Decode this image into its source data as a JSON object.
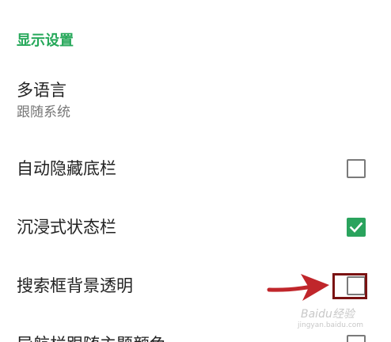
{
  "settings": {
    "section_header": "显示设置",
    "language": {
      "title": "多语言",
      "subtitle": "跟随系统"
    },
    "rows": [
      {
        "label": "自动隐藏底栏",
        "checked": false
      },
      {
        "label": "沉浸式状态栏",
        "checked": true
      },
      {
        "label": "搜索框背景透明",
        "checked": false
      },
      {
        "label": "导航栏跟随主题颜色",
        "checked": false
      }
    ]
  },
  "annotation": {
    "arrow_color": "#c0262b",
    "highlight_color": "#7a1212"
  },
  "watermark": {
    "brand": "Baidu经验",
    "url": "jingyan.baidu.com"
  },
  "colors": {
    "accent": "#26a85a",
    "checkbox_on": "#2aa35d",
    "checkbox_off_border": "#7a7a7a"
  }
}
